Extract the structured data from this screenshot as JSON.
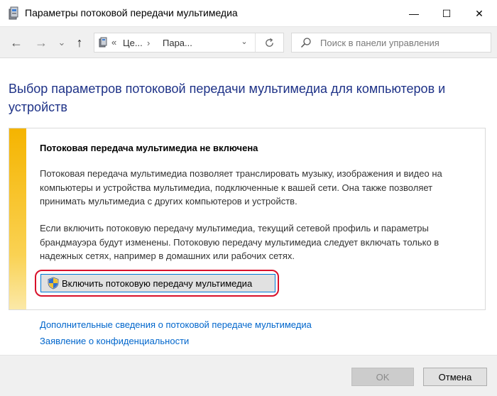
{
  "window": {
    "title": "Параметры потоковой передачи мультимедиа",
    "min_glyph": "—",
    "max_glyph": "☐",
    "close_glyph": "✕"
  },
  "nav": {
    "back_glyph": "←",
    "forward_glyph": "→",
    "recent_glyph": "⌄",
    "up_glyph": "↑"
  },
  "address": {
    "overflow_glyph": "«",
    "crumbs": [
      "Це...",
      "Пара..."
    ],
    "separator": "›",
    "dropdown_glyph": "⌄"
  },
  "search": {
    "placeholder": "Поиск в панели управления"
  },
  "main": {
    "title": "Выбор параметров потоковой передачи мультимедиа для компьютеров и устройств",
    "panel": {
      "heading": "Потоковая передача мультимедиа не включена",
      "paragraph1": "Потоковая передача мультимедиа позволяет транслировать музыку, изображения и видео на компьютеры и устройства мультимедиа, подключенные к вашей сети. Она также позволяет принимать мультимедиа с других компьютеров и устройств.",
      "paragraph2": "Если включить потоковую передачу мультимедиа, текущий сетевой профиль и параметры брандмауэра будут изменены. Потоковую передачу мультимедиа следует включать только в надежных сетях, например в домашних или рабочих сетях.",
      "enable_button": "Включить потоковую передачу мультимедиа"
    },
    "links": [
      "Дополнительные сведения о потоковой передаче мультимедиа",
      "Заявление о конфиденциальности"
    ]
  },
  "footer": {
    "ok": "OK",
    "cancel": "Отмена"
  },
  "colors": {
    "title_blue": "#1e3287",
    "link_blue": "#0066cc",
    "accent_yellow": "#f5b400",
    "highlight_red": "#d8102a",
    "focus_blue": "#0078d7"
  },
  "icons": {
    "title": "media-streaming-icon",
    "address": "control-panel-icon",
    "refresh": "refresh-icon",
    "search": "search-icon",
    "button": "uac-shield-icon"
  }
}
